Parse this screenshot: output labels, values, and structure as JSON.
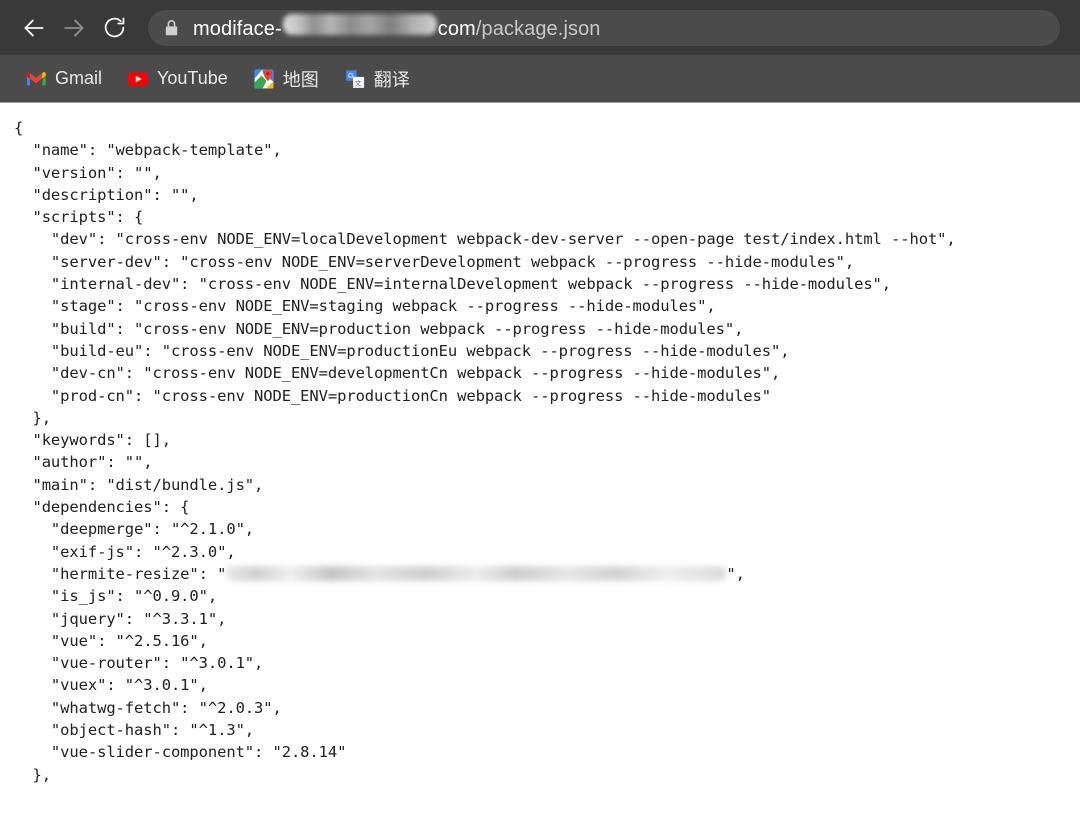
{
  "browser": {
    "nav": {
      "back_icon": "arrow-left-icon",
      "forward_icon": "arrow-right-icon",
      "reload_icon": "reload-icon"
    },
    "omnibox": {
      "lock_icon": "lock-icon",
      "url_prefix": "modiface-",
      "url_redacted": true,
      "url_host_suffix": "com",
      "url_path": "/package.json"
    },
    "bookmarks": [
      {
        "label": "Gmail",
        "icon": "gmail-icon"
      },
      {
        "label": "YouTube",
        "icon": "youtube-icon"
      },
      {
        "label": "地图",
        "icon": "google-maps-icon"
      },
      {
        "label": "翻译",
        "icon": "google-translate-icon"
      }
    ]
  },
  "document": {
    "lines": [
      "{",
      "  \"name\": \"webpack-template\",",
      "  \"version\": \"\",",
      "  \"description\": \"\",",
      "  \"scripts\": {",
      "    \"dev\": \"cross-env NODE_ENV=localDevelopment webpack-dev-server --open-page test/index.html --hot\",",
      "    \"server-dev\": \"cross-env NODE_ENV=serverDevelopment webpack --progress --hide-modules\",",
      "    \"internal-dev\": \"cross-env NODE_ENV=internalDevelopment webpack --progress --hide-modules\",",
      "    \"stage\": \"cross-env NODE_ENV=staging webpack --progress --hide-modules\",",
      "    \"build\": \"cross-env NODE_ENV=production webpack --progress --hide-modules\",",
      "    \"build-eu\": \"cross-env NODE_ENV=productionEu webpack --progress --hide-modules\",",
      "    \"dev-cn\": \"cross-env NODE_ENV=developmentCn webpack --progress --hide-modules\",",
      "    \"prod-cn\": \"cross-env NODE_ENV=productionCn webpack --progress --hide-modules\"",
      "  },",
      "  \"keywords\": [],",
      "  \"author\": \"\",",
      "  \"main\": \"dist/bundle.js\",",
      "  \"dependencies\": {",
      "    \"deepmerge\": \"^2.1.0\",",
      "    \"exif-js\": \"^2.3.0\",",
      "REDACTED_HERMITE",
      "    \"is_js\": \"^0.9.0\",",
      "    \"jquery\": \"^3.3.1\",",
      "    \"vue\": \"^2.5.16\",",
      "    \"vue-router\": \"^3.0.1\",",
      "    \"vuex\": \"^3.0.1\",",
      "    \"whatwg-fetch\": \"^2.0.3\",",
      "    \"object-hash\": \"^1.3\",",
      "    \"vue-slider-component\": \"2.8.14\"",
      "  },"
    ],
    "redacted_line": {
      "prefix": "    \"hermite-resize\": \"",
      "suffix": "\","
    }
  }
}
